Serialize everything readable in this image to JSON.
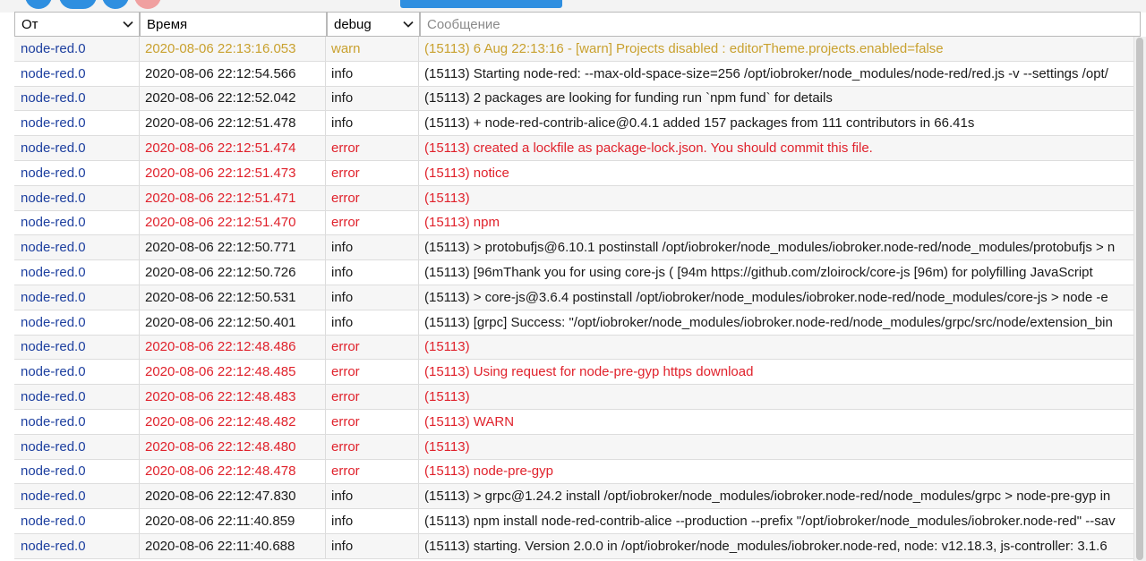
{
  "colors": {
    "warn": "#c9a12f",
    "error": "#e0222c",
    "info": "#1a1a1a",
    "source": "#1d3f9f",
    "accent": "#2f8fe0",
    "close": "#f0a0a0"
  },
  "filters": {
    "source": {
      "label": "От",
      "icon": "chevron-down-icon"
    },
    "time": {
      "label": "Время"
    },
    "level": {
      "label": "debug",
      "icon": "chevron-down-icon"
    },
    "message": {
      "placeholder": "Сообщение"
    }
  },
  "log": [
    {
      "source": "node-red.0",
      "time": "2020-08-06 22:13:16.053",
      "level": "warn",
      "message": "(15113) 6 Aug 22:13:16 - [warn] Projects disabled : editorTheme.projects.enabled=false"
    },
    {
      "source": "node-red.0",
      "time": "2020-08-06 22:12:54.566",
      "level": "info",
      "message": "(15113) Starting node-red: --max-old-space-size=256 /opt/iobroker/node_modules/node-red/red.js -v --settings /opt/"
    },
    {
      "source": "node-red.0",
      "time": "2020-08-06 22:12:52.042",
      "level": "info",
      "message": "(15113) 2 packages are looking for funding run `npm fund` for details"
    },
    {
      "source": "node-red.0",
      "time": "2020-08-06 22:12:51.478",
      "level": "info",
      "message": "(15113) + node-red-contrib-alice@0.4.1 added 157 packages from 111 contributors in 66.41s"
    },
    {
      "source": "node-red.0",
      "time": "2020-08-06 22:12:51.474",
      "level": "error",
      "message": "(15113) created a lockfile as package-lock.json. You should commit this file."
    },
    {
      "source": "node-red.0",
      "time": "2020-08-06 22:12:51.473",
      "level": "error",
      "message": "(15113) notice"
    },
    {
      "source": "node-red.0",
      "time": "2020-08-06 22:12:51.471",
      "level": "error",
      "message": "(15113)"
    },
    {
      "source": "node-red.0",
      "time": "2020-08-06 22:12:51.470",
      "level": "error",
      "message": "(15113) npm"
    },
    {
      "source": "node-red.0",
      "time": "2020-08-06 22:12:50.771",
      "level": "info",
      "message": "(15113) > protobufjs@6.10.1 postinstall /opt/iobroker/node_modules/iobroker.node-red/node_modules/protobufjs > n"
    },
    {
      "source": "node-red.0",
      "time": "2020-08-06 22:12:50.726",
      "level": "info",
      "message": "(15113)  [96mThank you for using core-js ( [94m https://github.com/zloirock/core-js  [96m) for polyfilling JavaScript"
    },
    {
      "source": "node-red.0",
      "time": "2020-08-06 22:12:50.531",
      "level": "info",
      "message": "(15113) > core-js@3.6.4 postinstall /opt/iobroker/node_modules/iobroker.node-red/node_modules/core-js > node -e"
    },
    {
      "source": "node-red.0",
      "time": "2020-08-06 22:12:50.401",
      "level": "info",
      "message": "(15113) [grpc] Success: \"/opt/iobroker/node_modules/iobroker.node-red/node_modules/grpc/src/node/extension_bin"
    },
    {
      "source": "node-red.0",
      "time": "2020-08-06 22:12:48.486",
      "level": "error",
      "message": "(15113)"
    },
    {
      "source": "node-red.0",
      "time": "2020-08-06 22:12:48.485",
      "level": "error",
      "message": "(15113) Using request for node-pre-gyp https download"
    },
    {
      "source": "node-red.0",
      "time": "2020-08-06 22:12:48.483",
      "level": "error",
      "message": "(15113)"
    },
    {
      "source": "node-red.0",
      "time": "2020-08-06 22:12:48.482",
      "level": "error",
      "message": "(15113) WARN"
    },
    {
      "source": "node-red.0",
      "time": "2020-08-06 22:12:48.480",
      "level": "error",
      "message": "(15113)"
    },
    {
      "source": "node-red.0",
      "time": "2020-08-06 22:12:48.478",
      "level": "error",
      "message": "(15113) node-pre-gyp"
    },
    {
      "source": "node-red.0",
      "time": "2020-08-06 22:12:47.830",
      "level": "info",
      "message": "(15113) > grpc@1.24.2 install /opt/iobroker/node_modules/iobroker.node-red/node_modules/grpc > node-pre-gyp in"
    },
    {
      "source": "node-red.0",
      "time": "2020-08-06 22:11:40.859",
      "level": "info",
      "message": "(15113) npm install node-red-contrib-alice --production --prefix \"/opt/iobroker/node_modules/iobroker.node-red\" --sav"
    },
    {
      "source": "node-red.0",
      "time": "2020-08-06 22:11:40.688",
      "level": "info",
      "message": "(15113) starting. Version 2.0.0 in /opt/iobroker/node_modules/iobroker.node-red, node: v12.18.3, js-controller: 3.1.6"
    }
  ]
}
